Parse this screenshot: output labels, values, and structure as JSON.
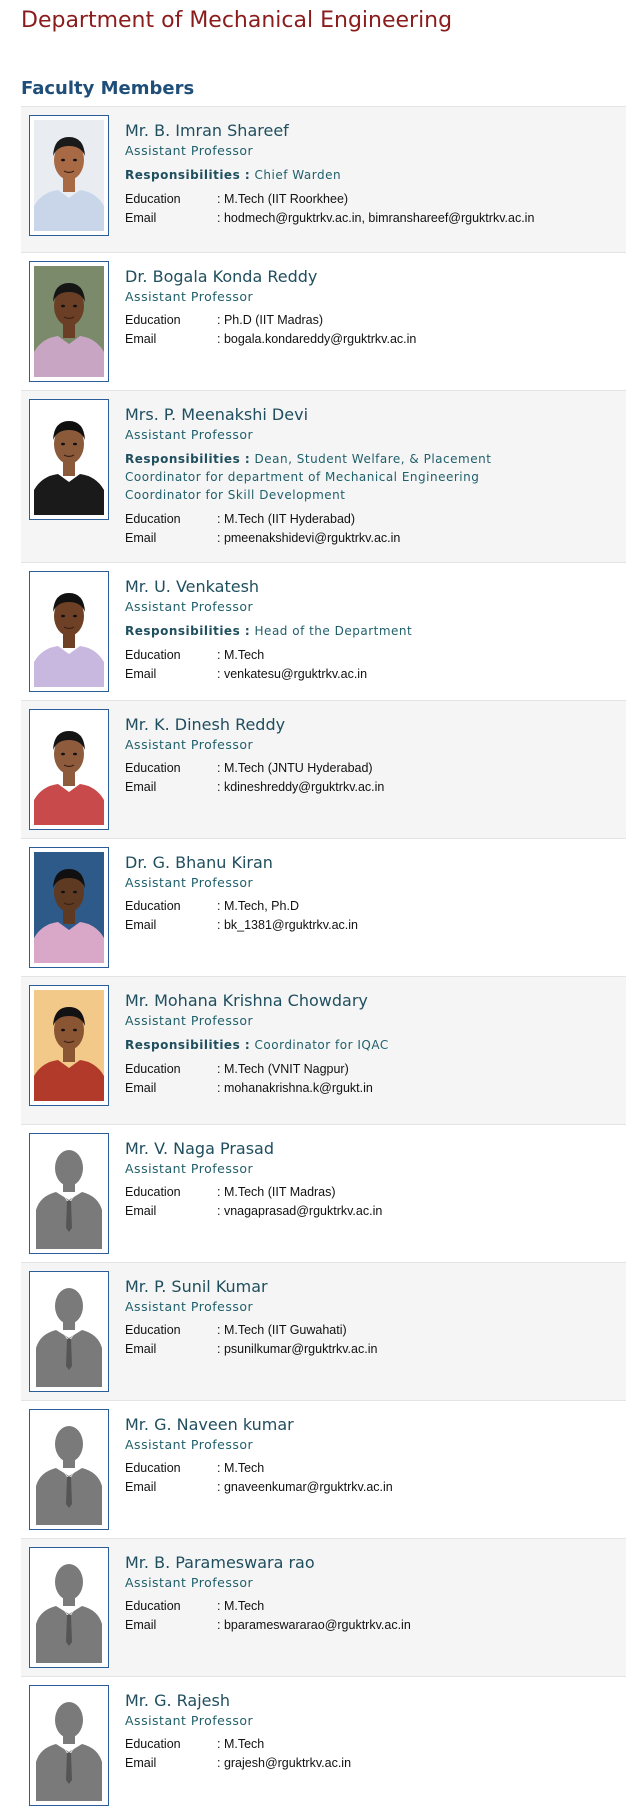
{
  "page": {
    "title": "Department of Mechanical Engineering",
    "section_title": "Faculty Members",
    "education_label": "Education",
    "email_label": "Email",
    "responsibilities_label": "Responsibilities :"
  },
  "faculty": [
    {
      "name": "Mr. B. Imran Shareef",
      "designation": "Assistant Professor",
      "responsibilities": "Chief Warden",
      "education": ": M.Tech (IIT Roorkhee)",
      "email": ": hodmech@rguktrkv.ac.in, bimranshareef@rguktrkv.ac.in",
      "photo": "photo"
    },
    {
      "name": "Dr. Bogala Konda Reddy",
      "designation": "Assistant Professor",
      "responsibilities": "",
      "education": ": Ph.D (IIT Madras)",
      "email": ": bogala.kondareddy@rguktrkv.ac.in",
      "photo": "photo"
    },
    {
      "name": "Mrs. P. Meenakshi Devi",
      "designation": "Assistant Professor",
      "responsibilities": "Dean, Student Welfare,  & Placement Coordinator for department of Mechanical Engineering Coordinator for Skill Development",
      "education": ": M.Tech (IIT Hyderabad)",
      "email": ": pmeenakshidevi@rguktrkv.ac.in",
      "photo": "photo"
    },
    {
      "name": "Mr. U. Venkatesh",
      "designation": "Assistant Professor",
      "responsibilities": "Head of the Department",
      "education": ": M.Tech",
      "email": ": venkatesu@rguktrkv.ac.in",
      "photo": "photo"
    },
    {
      "name": "Mr. K. Dinesh Reddy",
      "designation": "Assistant Professor",
      "responsibilities": "",
      "education": ": M.Tech (JNTU Hyderabad)",
      "email": ": kdineshreddy@rguktrkv.ac.in",
      "photo": "photo"
    },
    {
      "name": "Dr. G. Bhanu Kiran",
      "designation": "Assistant Professor",
      "responsibilities": "",
      "education": ": M.Tech, Ph.D",
      "email": ": bk_1381@rguktrkv.ac.in",
      "photo": "photo"
    },
    {
      "name": "Mr. Mohana Krishna Chowdary",
      "designation": "Assistant Professor",
      "responsibilities": "Coordinator for IQAC",
      "education": ": M.Tech (VNIT Nagpur)",
      "email": ": mohanakrishna.k@rgukt.in",
      "photo": "photo"
    },
    {
      "name": "Mr. V. Naga Prasad",
      "designation": "Assistant Professor",
      "responsibilities": "",
      "education": ": M.Tech (IIT Madras)",
      "email": ": vnagaprasad@rguktrkv.ac.in",
      "photo": "silhouette"
    },
    {
      "name": "Mr. P. Sunil Kumar",
      "designation": "Assistant Professor",
      "responsibilities": "",
      "education": ": M.Tech (IIT Guwahati)",
      "email": ": psunilkumar@rguktrkv.ac.in",
      "photo": "silhouette"
    },
    {
      "name": "Mr. G. Naveen kumar",
      "designation": "Assistant Professor",
      "responsibilities": "",
      "education": ": M.Tech",
      "email": ": gnaveenkumar@rguktrkv.ac.in",
      "photo": "silhouette"
    },
    {
      "name": "Mr. B. Parameswara rao",
      "designation": "Assistant Professor",
      "responsibilities": "",
      "education": ": M.Tech",
      "email": ": bparameswararao@rguktrkv.ac.in",
      "photo": "silhouette"
    },
    {
      "name": "Mr. G. Rajesh",
      "designation": "Assistant Professor",
      "responsibilities": "",
      "education": ": M.Tech",
      "email": ": grajesh@rguktrkv.ac.in",
      "photo": "silhouette"
    }
  ]
}
